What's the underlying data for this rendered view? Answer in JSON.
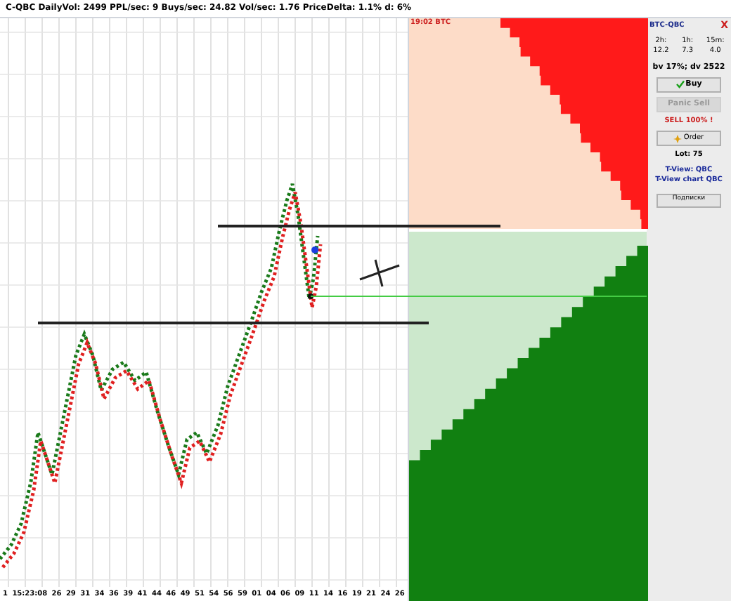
{
  "header": {
    "text": "C-QBC  DailyVol: 2499 PPL/sec: 9  Buys/sec: 24.82 Vol/sec: 1.76 PriceDelta: 1.1%  d: 6%"
  },
  "depth": {
    "label": "19:02 BTC"
  },
  "x_axis": [
    "1",
    "15:23:08",
    "26",
    "29",
    "31",
    "34",
    "36",
    "39",
    "41",
    "44",
    "46",
    "49",
    "51",
    "54",
    "56",
    "59",
    "01",
    "04",
    "06",
    "09",
    "11",
    "14",
    "16",
    "19",
    "21",
    "24",
    "26"
  ],
  "sidebar": {
    "title": "BTC-QBC",
    "close": "X",
    "stats": [
      {
        "label": "2h:",
        "value": "12.2"
      },
      {
        "label": "1h:",
        "value": "7.3"
      },
      {
        "label": "15m:",
        "value": "4.0"
      }
    ],
    "summary": "bv 17%; dv 2522",
    "buttons": [
      {
        "kind": "buy",
        "label": "Buy",
        "disabled": false
      },
      {
        "kind": "plain",
        "label": "Panic Sell",
        "disabled": true
      }
    ],
    "sell_notice": "SELL 100% !",
    "order_button": "Order",
    "lot": "Lot: 75",
    "links": [
      "T-View: QBC",
      "T-View chart QBC"
    ],
    "subscriptions_button": "Подписки"
  }
}
